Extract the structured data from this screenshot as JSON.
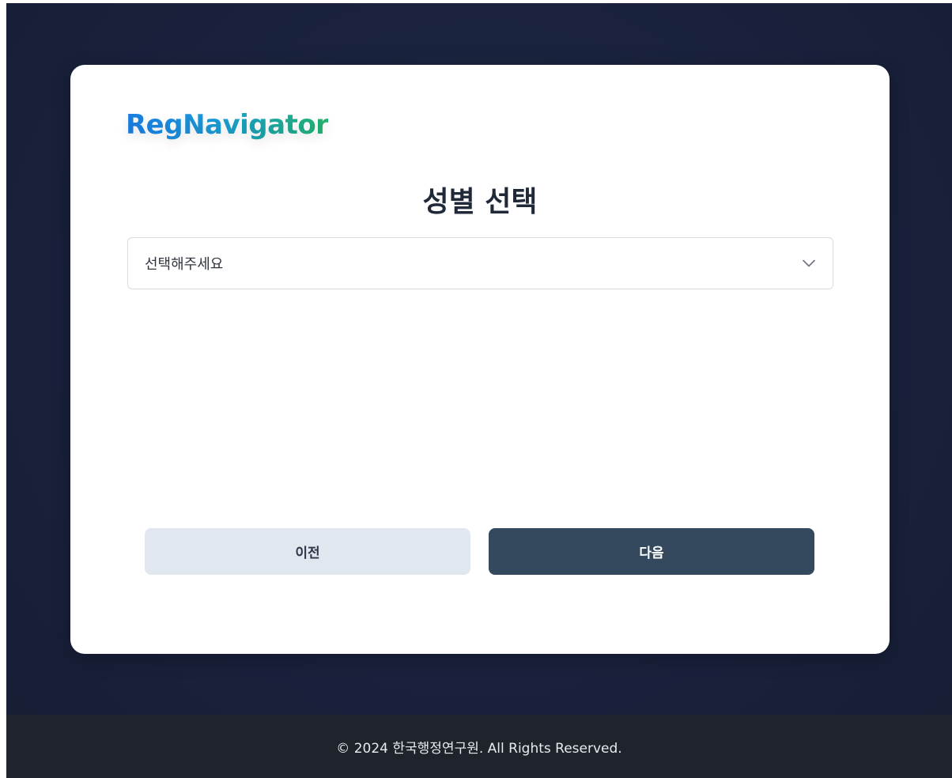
{
  "brand": {
    "logo_text": "RegNavigator"
  },
  "form": {
    "title": "성별 선택",
    "gender_select": {
      "placeholder": "선택해주세요",
      "icon": "chevron-down-icon"
    }
  },
  "buttons": {
    "prev_label": "이전",
    "next_label": "다음"
  },
  "footer": {
    "copyright": "© 2024 한국행정연구원. All Rights Reserved."
  },
  "colors": {
    "background": "#19213c",
    "card": "#ffffff",
    "prev_button": "#e1e7ef",
    "next_button": "#34495e",
    "footer": "#1f232b",
    "logo_gradient_start": "#1a7fe6",
    "logo_gradient_end": "#23b56e"
  }
}
